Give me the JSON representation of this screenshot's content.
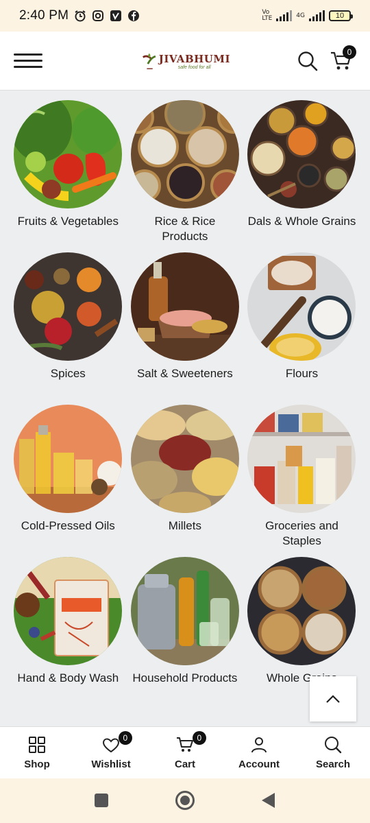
{
  "status_bar": {
    "time": "2:40 PM",
    "network": "4G",
    "battery": "10"
  },
  "header": {
    "logo_name": "JIVABHUMI",
    "logo_tagline": "safe food for all",
    "cart_count": "0"
  },
  "categories": [
    {
      "label": "Fruits & Vegetables",
      "icon": "vegetables-image"
    },
    {
      "label": "Rice & Rice Products",
      "icon": "rice-image"
    },
    {
      "label": "Dals & Whole Grains",
      "icon": "dals-image"
    },
    {
      "label": "Spices",
      "icon": "spices-image"
    },
    {
      "label": "Salt & Sweeteners",
      "icon": "salt-image"
    },
    {
      "label": "Flours",
      "icon": "flours-image"
    },
    {
      "label": "Cold-Pressed Oils",
      "icon": "oils-image"
    },
    {
      "label": "Millets",
      "icon": "millets-image"
    },
    {
      "label": "Groceries and Staples",
      "icon": "groceries-image"
    },
    {
      "label": "Hand & Body Wash",
      "icon": "handwash-image"
    },
    {
      "label": "Household Products",
      "icon": "household-image"
    },
    {
      "label": "Whole Grains",
      "icon": "grains-image"
    }
  ],
  "bottom_nav": {
    "shop": "Shop",
    "wishlist": "Wishlist",
    "wishlist_count": "0",
    "cart": "Cart",
    "cart_count": "0",
    "account": "Account",
    "search": "Search"
  },
  "colors": {
    "brand": "#7a2a1f",
    "brand_green": "#5c7a2a",
    "background": "#eceeef",
    "status_bar": "#fdf3e3"
  }
}
